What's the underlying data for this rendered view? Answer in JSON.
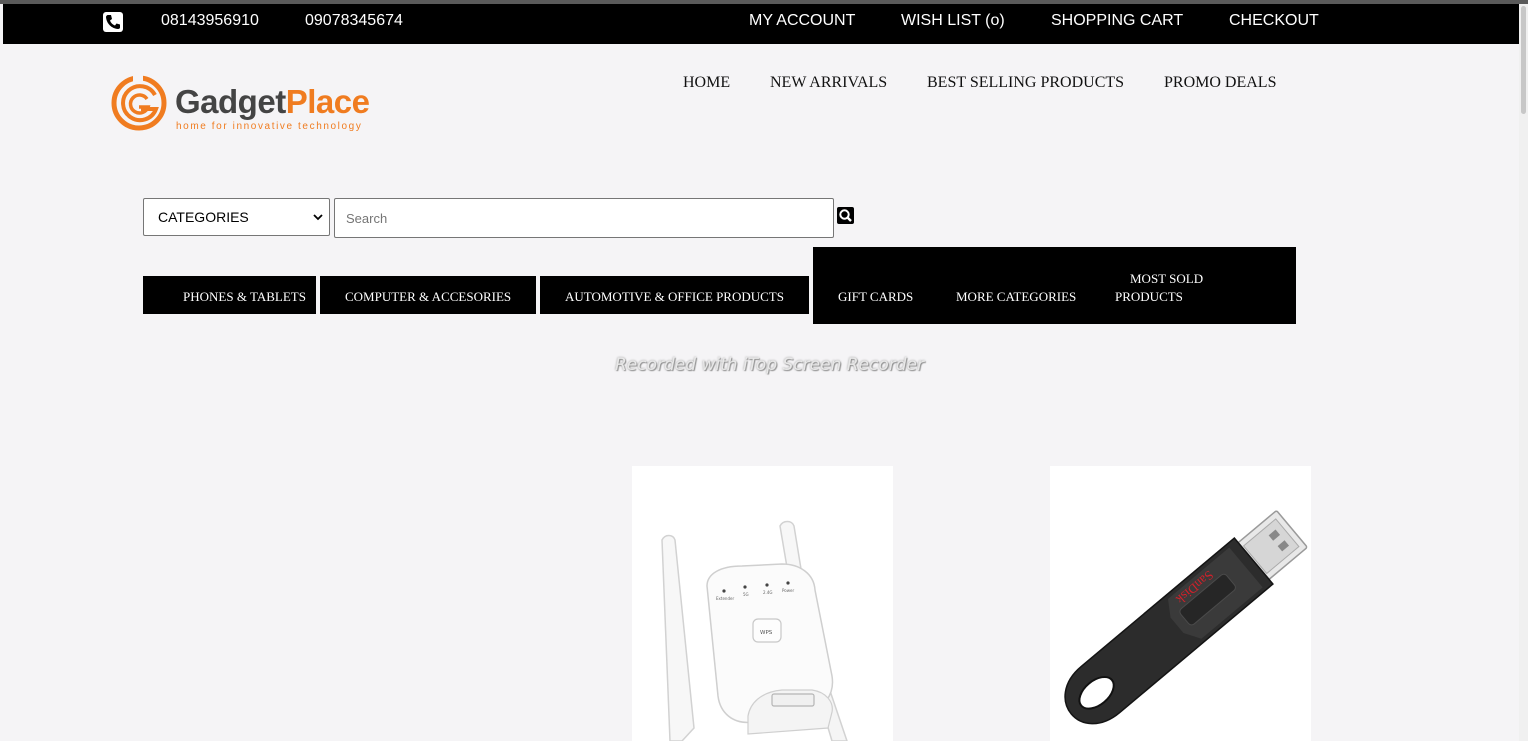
{
  "topbar": {
    "phone1": "08143956910",
    "phone2": "09078345674",
    "links": [
      "MY ACCOUNT",
      "WISH LIST (o)",
      "SHOPPING CART",
      "CHECKOUT"
    ]
  },
  "logo": {
    "name_part1": "Gadget",
    "name_part2": "Place",
    "tagline": "home for innovative technology"
  },
  "main_nav": [
    "HOME",
    "NEW ARRIVALS",
    "BEST SELLING PRODUCTS",
    "PROMO DEALS"
  ],
  "search": {
    "category_selected": "CATEGORIES",
    "placeholder": "Search"
  },
  "categories": {
    "phones": "PHONES & TABLETS",
    "computer": "COMPUTER & ACCESORIES",
    "automotive": "AUTOMOTIVE & OFFICE PRODUCTS",
    "gift": "GIFT CARDS",
    "more": "MORE CATEGORIES",
    "most_sold_line1": "MOST SOLD",
    "most_sold_line2": "PRODUCTS"
  },
  "watermark": "Recorded with iTop Screen Recorder",
  "products": {
    "usb_brand": "SanDisk",
    "extender_button": "WPS",
    "extender_leds": [
      "Extender",
      "5G",
      "2.4G",
      "Power"
    ]
  },
  "colors": {
    "brand_orange": "#f07c20",
    "bar_black": "#000000",
    "page_bg": "#f5f4f6"
  }
}
